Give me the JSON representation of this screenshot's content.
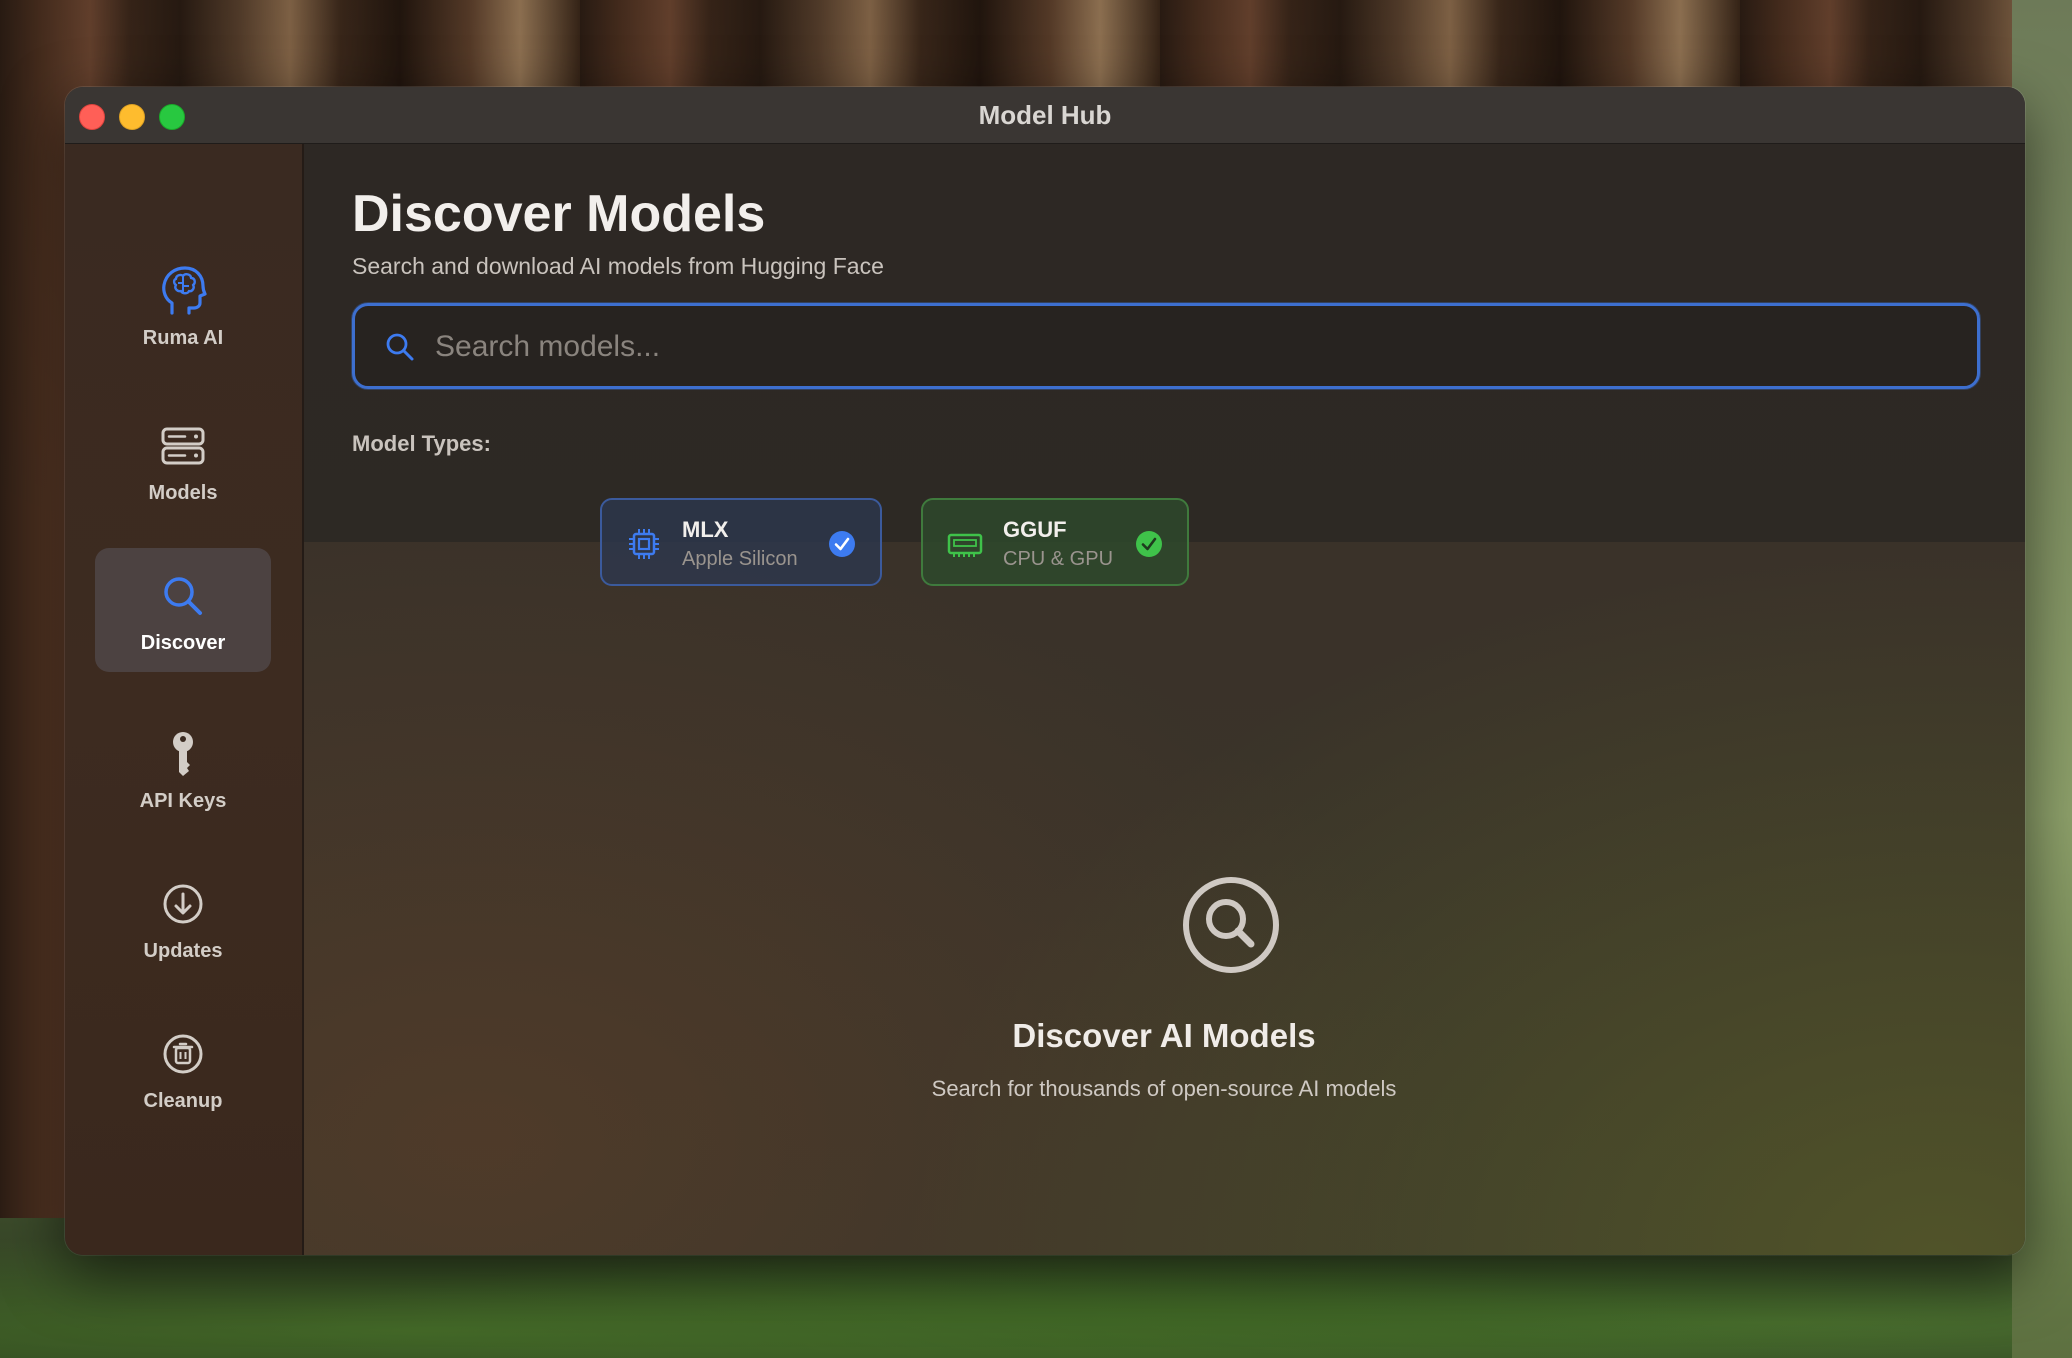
{
  "window": {
    "title": "Model Hub"
  },
  "sidebar": {
    "items": [
      {
        "label": "Ruma AI",
        "icon": "brain-head-icon",
        "active": false
      },
      {
        "label": "Models",
        "icon": "server-stack-icon",
        "active": false
      },
      {
        "label": "Discover",
        "icon": "search-icon",
        "active": true
      },
      {
        "label": "API Keys",
        "icon": "key-icon",
        "active": false
      },
      {
        "label": "Updates",
        "icon": "download-circle-icon",
        "active": false
      },
      {
        "label": "Cleanup",
        "icon": "trash-circle-icon",
        "active": false
      }
    ]
  },
  "header": {
    "title": "Discover Models",
    "subtitle": "Search and download AI models from Hugging Face"
  },
  "search": {
    "placeholder": "Search models...",
    "value": ""
  },
  "model_types": {
    "label": "Model Types:",
    "options": [
      {
        "name": "MLX",
        "subtitle": "Apple Silicon",
        "selected": true,
        "icon": "chip-icon",
        "color": "#3d7bf0"
      },
      {
        "name": "GGUF",
        "subtitle": "CPU & GPU",
        "selected": true,
        "icon": "memory-card-icon",
        "color": "#3fc24a"
      }
    ]
  },
  "empty_state": {
    "icon": "magnifier-circle-icon",
    "title": "Discover AI Models",
    "subtitle": "Search for thousands of open-source AI models"
  },
  "colors": {
    "accent_blue": "#3d7bf0",
    "accent_green": "#3fc24a",
    "traffic_close": "#ff5f57",
    "traffic_minimize": "#febc2e",
    "traffic_zoom": "#28c840"
  }
}
